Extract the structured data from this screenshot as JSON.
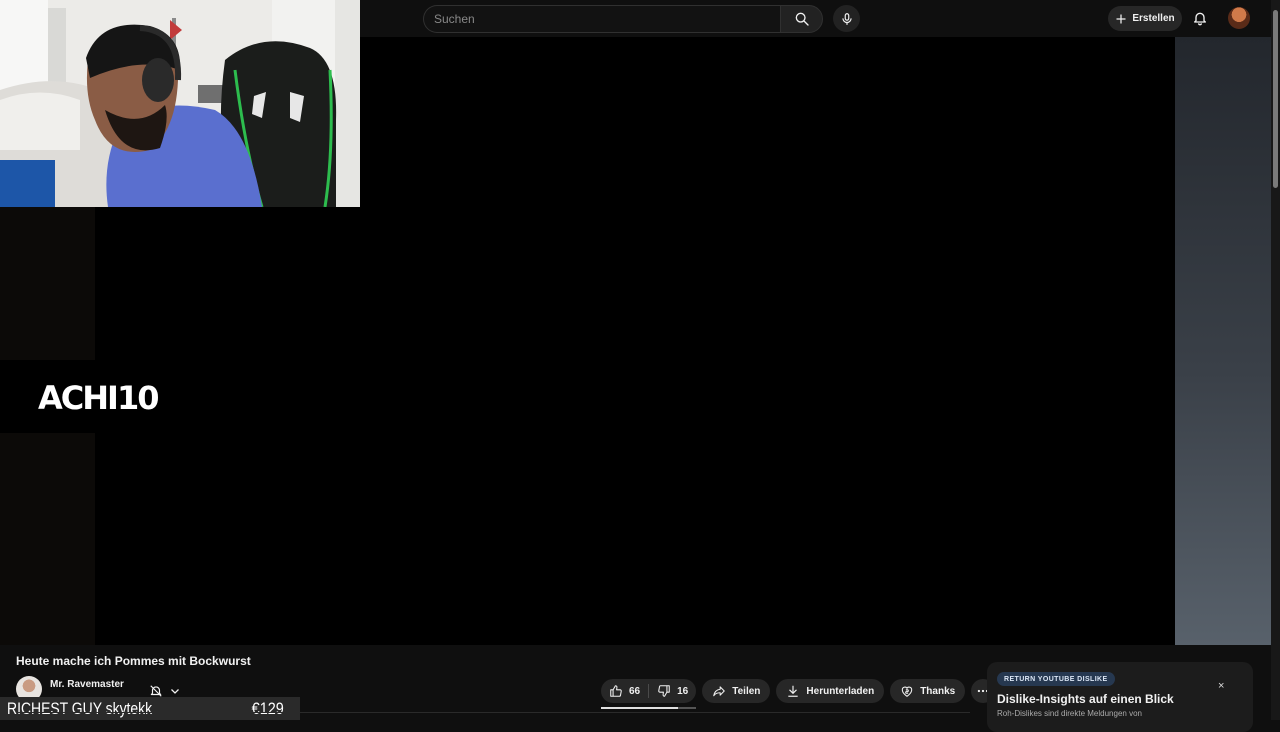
{
  "search": {
    "placeholder": "Suchen"
  },
  "header": {
    "create_label": "Erstellen"
  },
  "player": {
    "overlay_logo": "ACHI10"
  },
  "video": {
    "title": "Heute mache ich Pommes mit Bockwurst",
    "channel": "Mr. Ravemaster",
    "like_count": "66",
    "dislike_count": "16",
    "like_ratio": 0.81
  },
  "actions": {
    "share_label": "Teilen",
    "download_label": "Herunterladen",
    "thanks_label": "Thanks"
  },
  "donation": {
    "label": "RICHEST GUY skytekk",
    "amount": "€129"
  },
  "ryd": {
    "badge": "RETURN YOUTUBE DISLIKE",
    "title": "Dislike-Insights auf einen Blick",
    "subtitle": "Roh-Dislikes sind direkte Meldungen von",
    "close": "×"
  },
  "colors": {
    "background": "#0f0f0f",
    "pill": "#272727",
    "badge": "#263850"
  },
  "icons": [
    "search-icon",
    "microphone-icon",
    "plus-icon",
    "bell-icon",
    "bell-off-icon",
    "chevron-down-icon",
    "thumbs-up-icon",
    "thumbs-down-icon",
    "share-icon",
    "download-icon",
    "thanks-icon",
    "more-icon",
    "close-icon"
  ]
}
